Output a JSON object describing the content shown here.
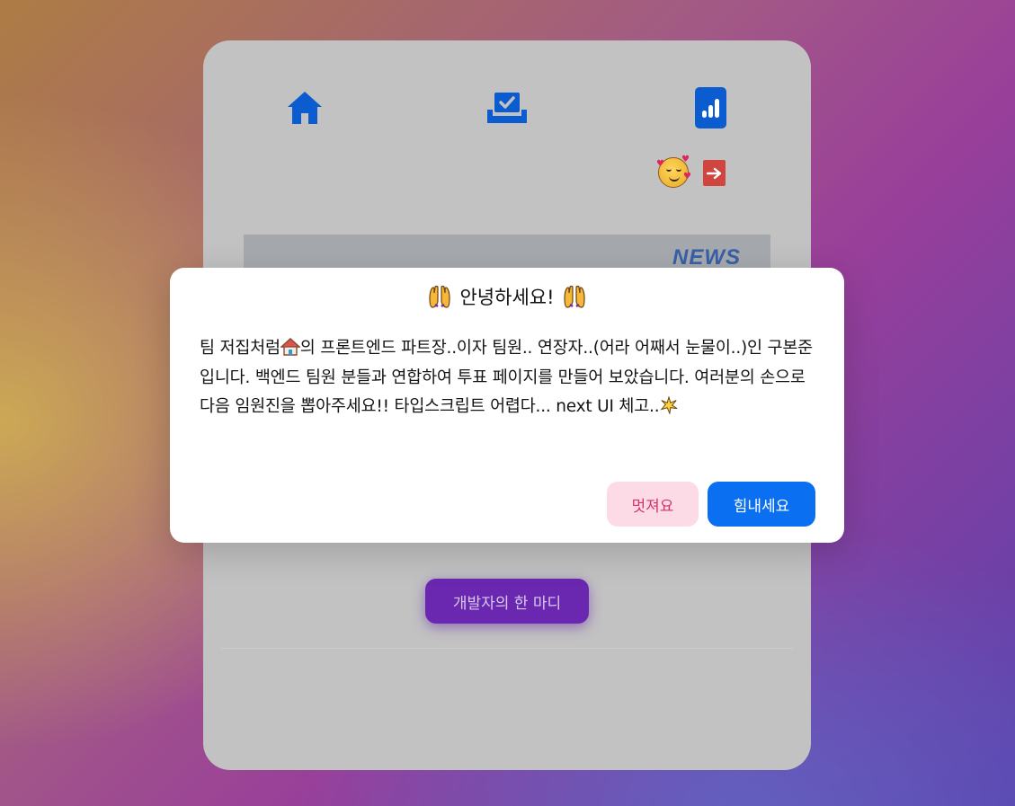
{
  "colors": {
    "accent_blue": "#0b6ff2",
    "nav_icon_blue": "#0a5ccf",
    "dev_button_purple": "#6a28b0",
    "logout_red": "#d0453f",
    "cool_button_bg": "#fddbe6",
    "cool_button_text": "#d6336c"
  },
  "nav": {
    "items": [
      {
        "name": "home",
        "icon": "home-icon"
      },
      {
        "name": "vote",
        "icon": "vote-box-icon"
      },
      {
        "name": "stats",
        "icon": "bar-chart-icon"
      }
    ],
    "profile_icon": "smiling-face-with-hearts-icon",
    "logout_icon": "logout-icon"
  },
  "news_banner": {
    "label": "NEWS"
  },
  "dev_button_label": "개발자의 한 마디",
  "modal": {
    "title_icon": "raising-hands-icon",
    "title": "안녕하세요!",
    "body_part1": "팀 저집처럼",
    "body_icon1": "house-icon",
    "body_part2": "의 프론트엔드 파트장..이자 팀원.. 연장자..(어라 어째서 눈물이..)인 구본준 입니다. 백엔드 팀원 분들과 연합하여 투표 페이지를 만들어 보았습니다. 여러분의 손으로 다음 임원진을 뽑아주세요!! 타입스크립트 어렵다... next UI 체고..",
    "body_icon2": "sparkle-burst-icon",
    "cool_button": "멋져요",
    "cheer_button": "힘내세요"
  }
}
